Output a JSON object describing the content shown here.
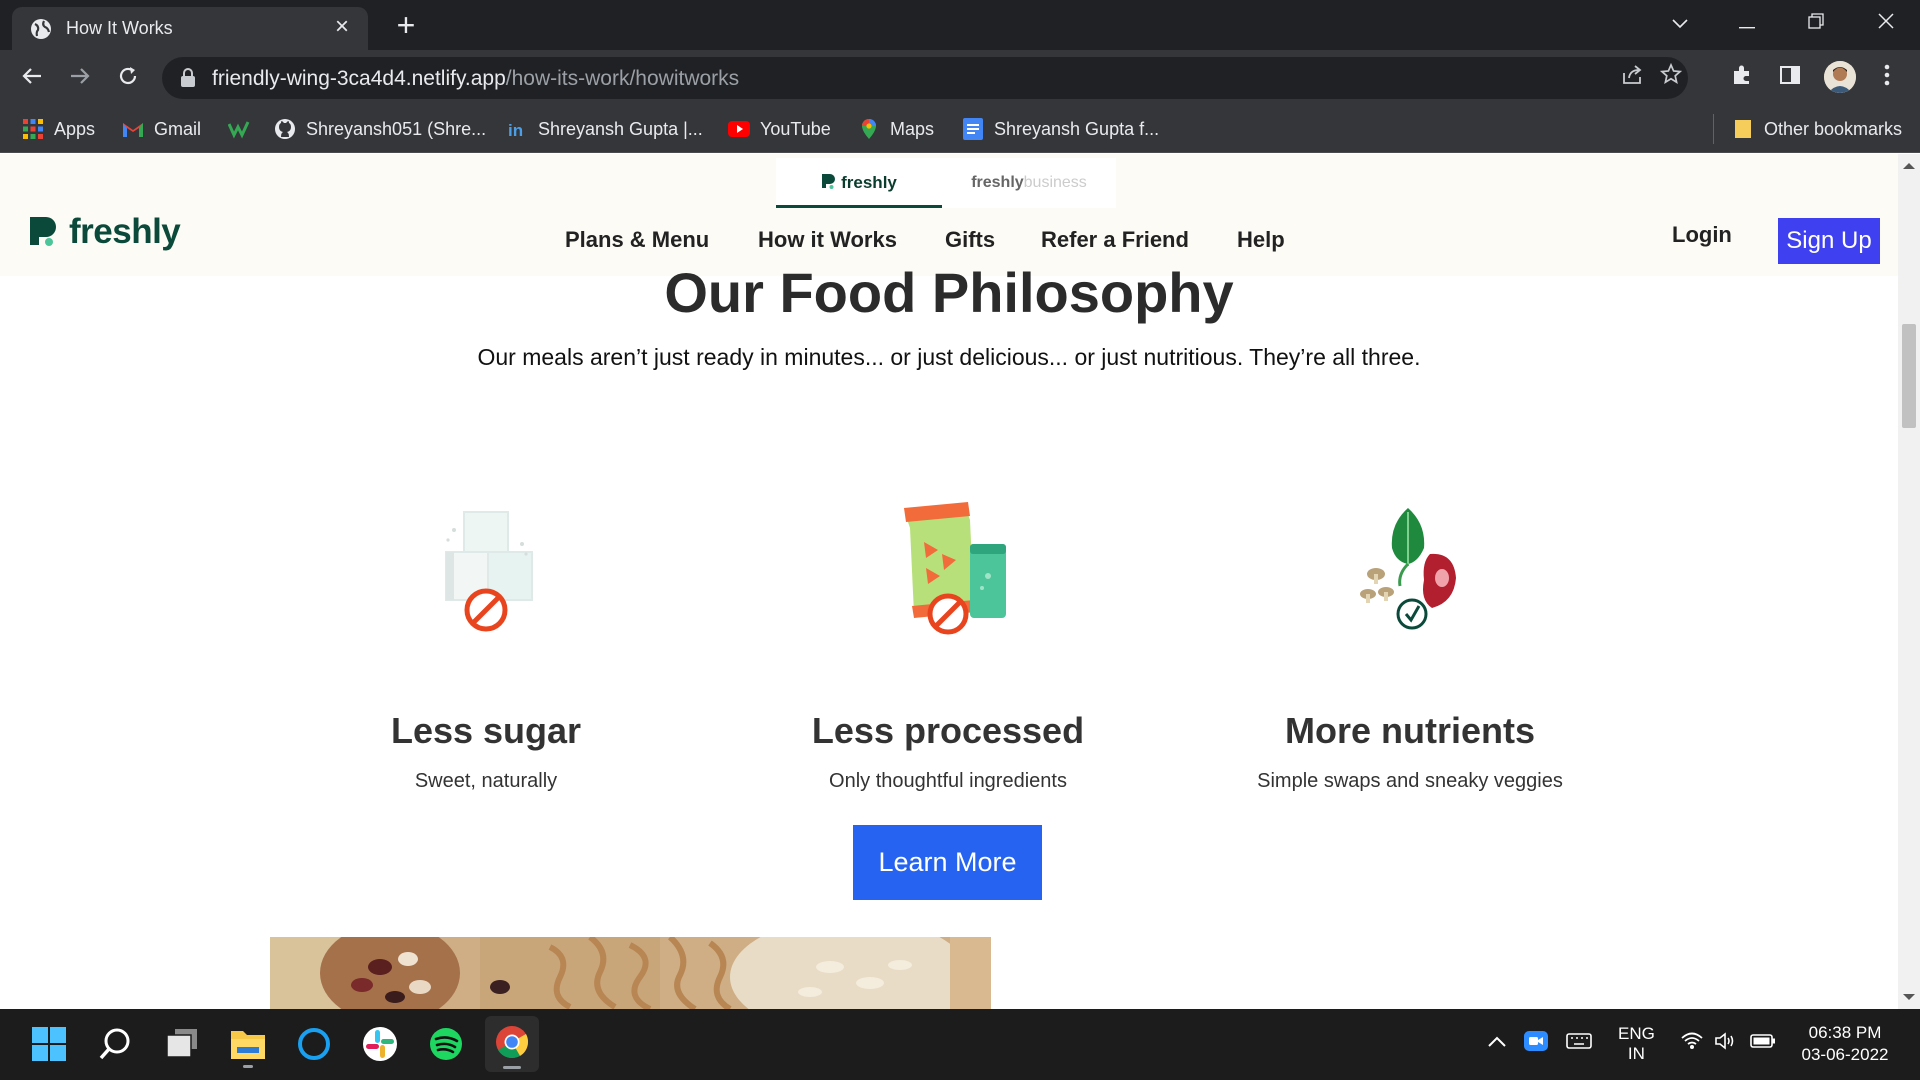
{
  "browser": {
    "tab_title": "How It Works",
    "url_host": "friendly-wing-3ca4d4.netlify.app",
    "url_path": "/how-its-work/howitworks",
    "bookmarks": [
      {
        "label": "Apps"
      },
      {
        "label": "Gmail"
      },
      {
        "label": "Shreyansh051 (Shre..."
      },
      {
        "label": "Shreyansh Gupta |..."
      },
      {
        "label": "YouTube"
      },
      {
        "label": "Maps"
      },
      {
        "label": "Shreyansh Gupta f..."
      }
    ],
    "other_bookmarks": "Other bookmarks"
  },
  "site": {
    "brand_tabs": {
      "freshly": "freshly",
      "business_prefix": "freshly",
      "business_suffix": "business"
    },
    "logo_text": "freshly",
    "nav": [
      "Plans & Menu",
      "How it Works",
      "Gifts",
      "Refer a Friend",
      "Help"
    ],
    "login": "Login",
    "signup": "Sign Up"
  },
  "philosophy": {
    "title": "Our Food Philosophy",
    "subtitle": "Our meals aren’t just ready in minutes... or just delicious... or just nutritious. They’re all three.",
    "features": [
      {
        "title": "Less sugar",
        "subtitle": "Sweet, naturally",
        "icon": "sugar-cubes-icon"
      },
      {
        "title": "Less processed",
        "subtitle": "Only thoughtful ingredients",
        "icon": "snack-bag-icon"
      },
      {
        "title": "More nutrients",
        "subtitle": "Simple swaps and sneaky veggies",
        "icon": "veggies-icon"
      }
    ],
    "cta": "Learn More"
  },
  "taskbar": {
    "lang_top": "ENG",
    "lang_bottom": "IN",
    "time": "06:38 PM",
    "date": "03-06-2022"
  },
  "colors": {
    "signup_bg": "#3f40f0",
    "cta_bg": "#2563f0",
    "brand_green": "#0b4a3a"
  }
}
